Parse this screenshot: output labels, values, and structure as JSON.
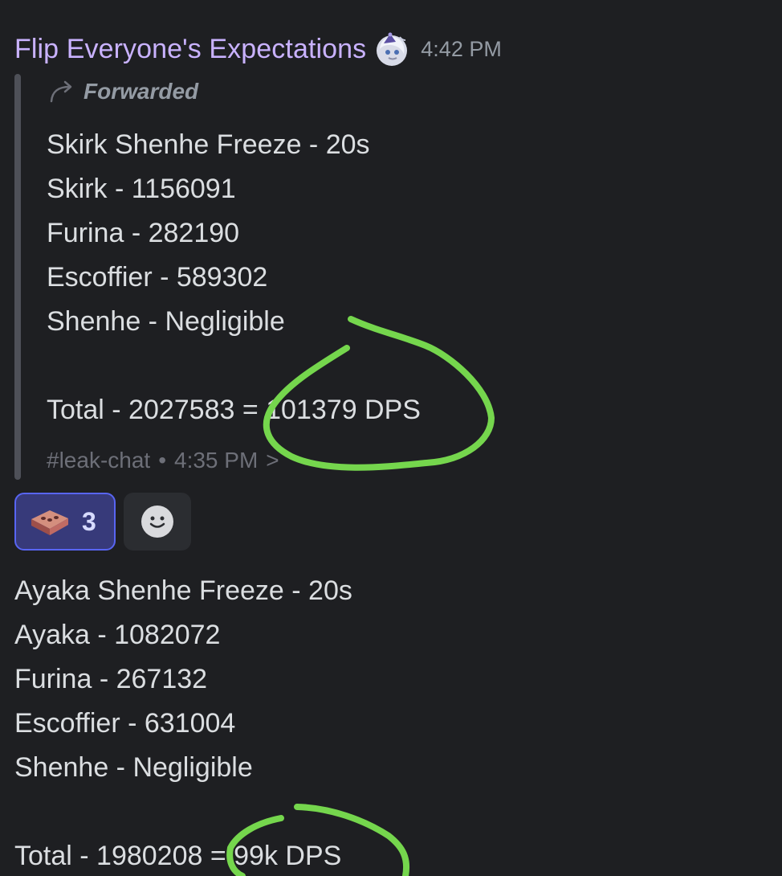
{
  "header": {
    "username": "Flip Everyone's Expectations",
    "timestamp": "4:42 PM",
    "avatar_icon": "anime-avatar-icon"
  },
  "forwarded_message": {
    "label": "Forwarded",
    "lines": [
      "Skirk Shenhe Freeze - 20s",
      "Skirk - 1156091",
      "Furina - 282190",
      "Escoffier - 589302",
      "Shenhe - Negligible",
      "Total - 2027583 = 101379 DPS"
    ],
    "source_channel": "#leak-chat",
    "source_time": "4:35 PM",
    "source_arrow": ">"
  },
  "reactions": {
    "brick_count": "3",
    "brick_icon": "brick-icon",
    "add_icon": "smiley-add-reaction-icon"
  },
  "reply_message": {
    "lines": [
      "Ayaka Shenhe Freeze - 20s",
      "Ayaka - 1082072",
      "Furina - 267132",
      "Escoffier - 631004",
      "Shenhe - Negligible",
      "Total - 1980208 = 99k DPS"
    ]
  },
  "colors": {
    "background": "#1e1f22",
    "username": "#c9b2ff",
    "annotation": "#75d64d",
    "reaction_highlight": "#5865f2"
  }
}
